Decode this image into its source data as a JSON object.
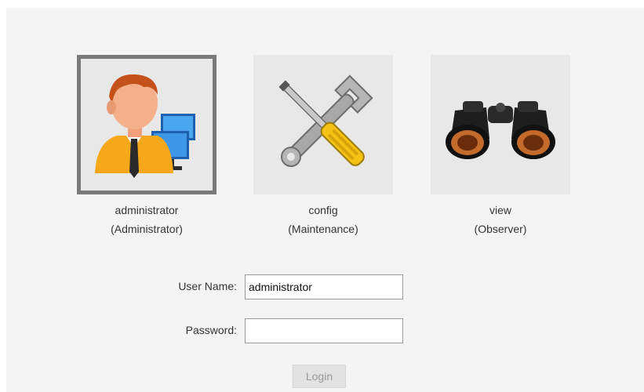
{
  "users": [
    {
      "name": "administrator",
      "role": "(Administrator)",
      "icon": "administrator-avatar-icon",
      "selected": true
    },
    {
      "name": "config",
      "role": "(Maintenance)",
      "icon": "tools-icon",
      "selected": false
    },
    {
      "name": "view",
      "role": "(Observer)",
      "icon": "binoculars-icon",
      "selected": false
    }
  ],
  "form": {
    "username_label": "User Name:",
    "username_value": "administrator",
    "password_label": "Password:",
    "password_value": "",
    "login_label": "Login"
  }
}
